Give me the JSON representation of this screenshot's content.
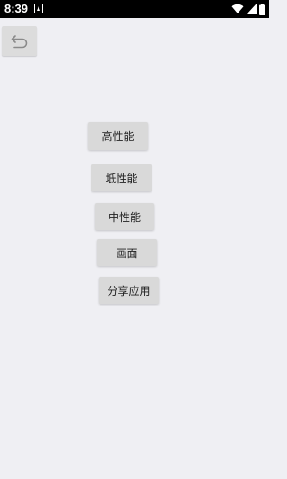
{
  "status_bar": {
    "time": "8:39",
    "icons": [
      "notification-app-icon",
      "wifi-icon",
      "signal-icon",
      "battery-icon"
    ]
  },
  "toolbar": {
    "back_icon": "undo-back-icon"
  },
  "menu": {
    "high_performance": "高性能",
    "low_performance": "坻性能",
    "mid_performance": "中性能",
    "graphics": "画面",
    "share_app": "分享应用"
  },
  "colors": {
    "background": "#efeff3",
    "button": "#d9d9d9",
    "status_bar": "#000000"
  }
}
